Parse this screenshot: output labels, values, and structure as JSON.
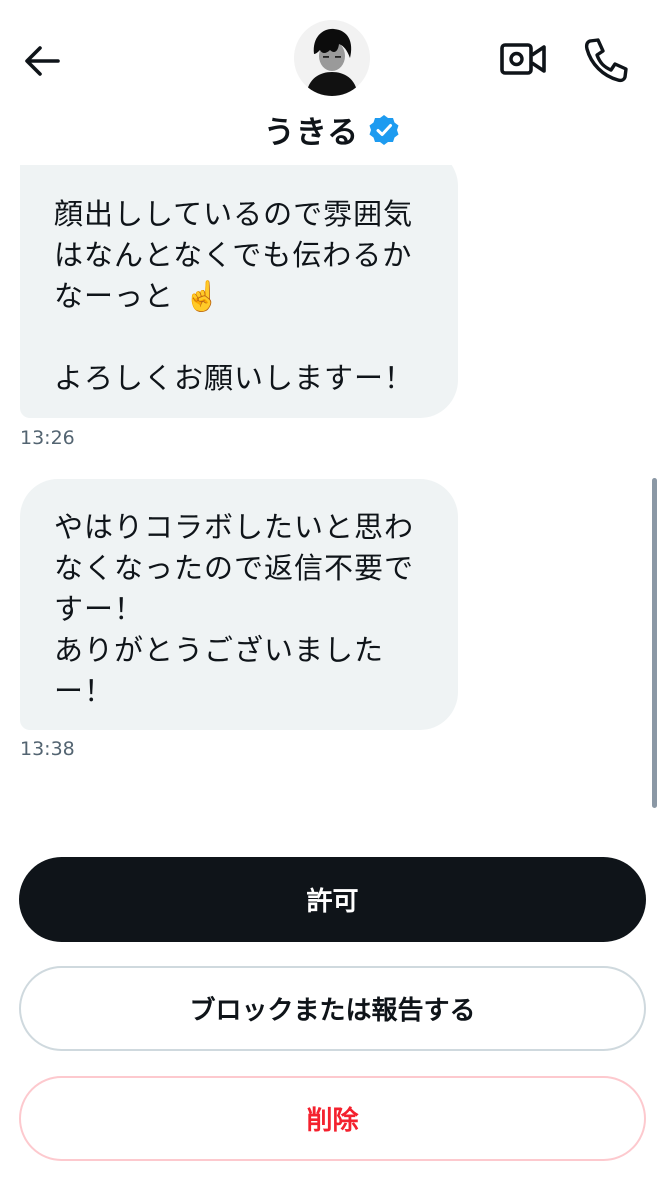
{
  "header": {
    "contact_name": "うきる",
    "icons": {
      "back": "arrow-left-icon",
      "video": "video-call-icon",
      "call": "phone-icon",
      "verified": "verified-badge-icon"
    },
    "verified_color": "#1d9bf0"
  },
  "messages": [
    {
      "text": "顔出ししているので雰囲気\nはなんとなくでも伝わるか\nなーっと ☝️\n\nよろしくお願いしますー！",
      "time": "13:26"
    },
    {
      "text": "やはりコラボしたいと思わ\nなくなったので返信不要で\nすー！\nありがとうございました\nー！",
      "time": "13:38"
    }
  ],
  "actions": {
    "allow_label": "許可",
    "block_label": "ブロックまたは報告する",
    "delete_label": "削除"
  },
  "colors": {
    "bubble": "#eff3f4",
    "primary_button": "#0f1419",
    "danger": "#f4212e"
  }
}
